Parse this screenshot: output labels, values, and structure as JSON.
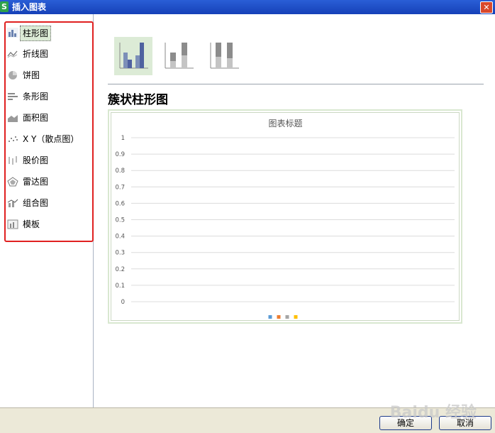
{
  "window": {
    "title": "插入图表",
    "app_icon_letter": "S",
    "close_symbol": "✕"
  },
  "sidebar": {
    "items": [
      {
        "label": "柱形图",
        "icon": "column-chart-icon",
        "selected": true
      },
      {
        "label": "折线图",
        "icon": "line-chart-icon"
      },
      {
        "label": "饼图",
        "icon": "pie-chart-icon"
      },
      {
        "label": "条形图",
        "icon": "bar-chart-icon"
      },
      {
        "label": "面积图",
        "icon": "area-chart-icon"
      },
      {
        "label": "X Y（散点图）",
        "icon": "scatter-chart-icon"
      },
      {
        "label": "股价图",
        "icon": "stock-chart-icon"
      },
      {
        "label": "雷达图",
        "icon": "radar-chart-icon"
      },
      {
        "label": "组合图",
        "icon": "combo-chart-icon"
      },
      {
        "label": "模板",
        "icon": "template-icon"
      }
    ]
  },
  "subtypes": [
    {
      "icon": "clustered-column-icon",
      "selected": true
    },
    {
      "icon": "stacked-column-icon"
    },
    {
      "icon": "percent-stacked-column-icon"
    }
  ],
  "main": {
    "heading": "簇状柱形图"
  },
  "chart_data": {
    "type": "bar",
    "title": "图表标题",
    "categories": [],
    "series": [
      {
        "values": [],
        "color": "#5b9bd5"
      },
      {
        "values": [],
        "color": "#ed7d31"
      },
      {
        "values": [],
        "color": "#a5a5a5"
      },
      {
        "values": [],
        "color": "#ffc000"
      }
    ],
    "ylim": [
      0,
      1
    ],
    "yticks": [
      "1",
      "0.9",
      "0.8",
      "0.7",
      "0.6",
      "0.5",
      "0.4",
      "0.3",
      "0.2",
      "0.1",
      "0"
    ],
    "grid": true,
    "legend": "bottom"
  },
  "footer": {
    "ok_label": "确定",
    "cancel_label": "取消"
  },
  "watermark": "Baidu 经验"
}
